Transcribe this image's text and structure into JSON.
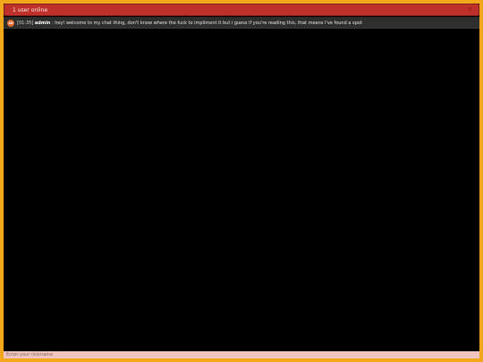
{
  "header": {
    "title": "1 user online",
    "close_symbol": "×"
  },
  "messages": [
    {
      "avatar_initials": "AD",
      "time": "[01:35]",
      "user": "admin",
      "separator": ":",
      "text": "hey! welcome to my chat thing, don't know where the fuck to impliment it but i guess if you're reading this, that means I've found a spot"
    }
  ],
  "input": {
    "placeholder": "Enter your nickname",
    "value": ""
  },
  "colors": {
    "border": "#f3a81c",
    "header": "#c0302a",
    "message_row": "#2e2e2e",
    "avatar": "#e2682c",
    "chat_background": "#000000",
    "input_background": "#f0c4bf"
  },
  "icons": {
    "close": "close-icon",
    "avatar": "user-avatar"
  }
}
